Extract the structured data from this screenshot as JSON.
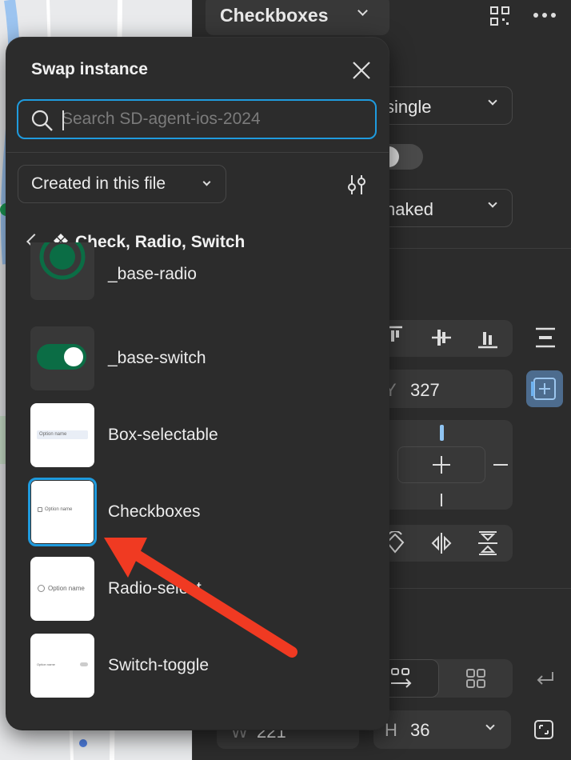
{
  "panel": {
    "component_name": "Checkboxes",
    "prop_select_1": "single",
    "prop_select_2": "naked",
    "y_label": "Y",
    "y_value": "327",
    "w_label": "W",
    "w_value": "221",
    "h_label": "H",
    "h_value": "36"
  },
  "popover": {
    "title": "Swap instance",
    "search_placeholder": "Search SD-agent-ios-2024",
    "filter_label": "Created in this file",
    "breadcrumb": "Check, Radio, Switch",
    "items": [
      {
        "label": "_base-radio",
        "thumb_text": ""
      },
      {
        "label": "_base-switch",
        "thumb_text": ""
      },
      {
        "label": "Box-selectable",
        "thumb_text": "Option name"
      },
      {
        "label": "Checkboxes",
        "thumb_text": "Option name"
      },
      {
        "label": "Radio-select",
        "thumb_text": "Option name"
      },
      {
        "label": "Switch-toggle",
        "thumb_text": "Option name"
      }
    ]
  },
  "colors": {
    "accent": "#1f9bde",
    "switch_on": "#0b6d45",
    "annotation_arrow": "#f03a22"
  }
}
